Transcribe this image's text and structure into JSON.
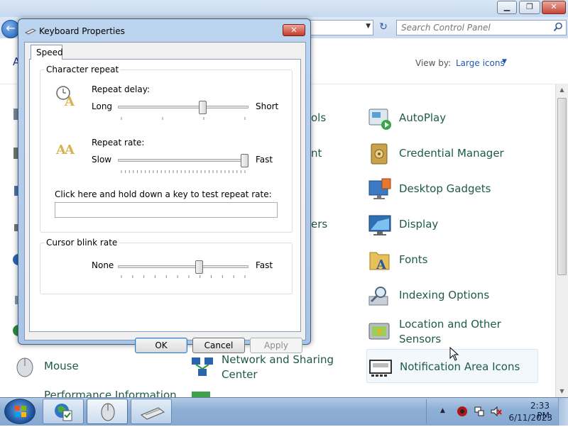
{
  "control_panel": {
    "search_placeholder": "Search Control Panel",
    "heading_fragment": "A",
    "view_by_label": "View by:",
    "view_by_value": "Large icons",
    "items": {
      "autoplay": "AutoPlay",
      "credential_manager": "Credential Manager",
      "desktop_gadgets": "Desktop Gadgets",
      "display": "Display",
      "fonts": "Fonts",
      "indexing_options": "Indexing Options",
      "location_line1": "Location and Other",
      "location_line2": "Sensors",
      "notification_area_icons": "Notification Area Icons",
      "mouse": "Mouse",
      "network_line1": "Network and Sharing",
      "network_line2": "Center",
      "performance": "Performance Information"
    },
    "partial_labels": {
      "tools": "ols",
      "nt": "nt",
      "ers": "ers"
    }
  },
  "dialog": {
    "title": "Keyboard Properties",
    "tab_speed": "Speed",
    "character_repeat": {
      "group_title": "Character repeat",
      "repeat_delay_label": "Repeat delay:",
      "delay_left": "Long",
      "delay_right": "Short",
      "delay_level": 0.66,
      "repeat_rate_label": "Repeat rate:",
      "rate_left": "Slow",
      "rate_right": "Fast",
      "rate_level": 1.0,
      "test_label": "Click here and hold down a key to test repeat rate:"
    },
    "cursor_blink": {
      "group_title": "Cursor blink rate",
      "left": "None",
      "right": "Fast",
      "level": 0.63
    },
    "buttons": {
      "ok": "OK",
      "cancel": "Cancel",
      "apply": "Apply"
    }
  },
  "taskbar": {
    "time": "2:33 PM",
    "date": "6/11/2023"
  }
}
